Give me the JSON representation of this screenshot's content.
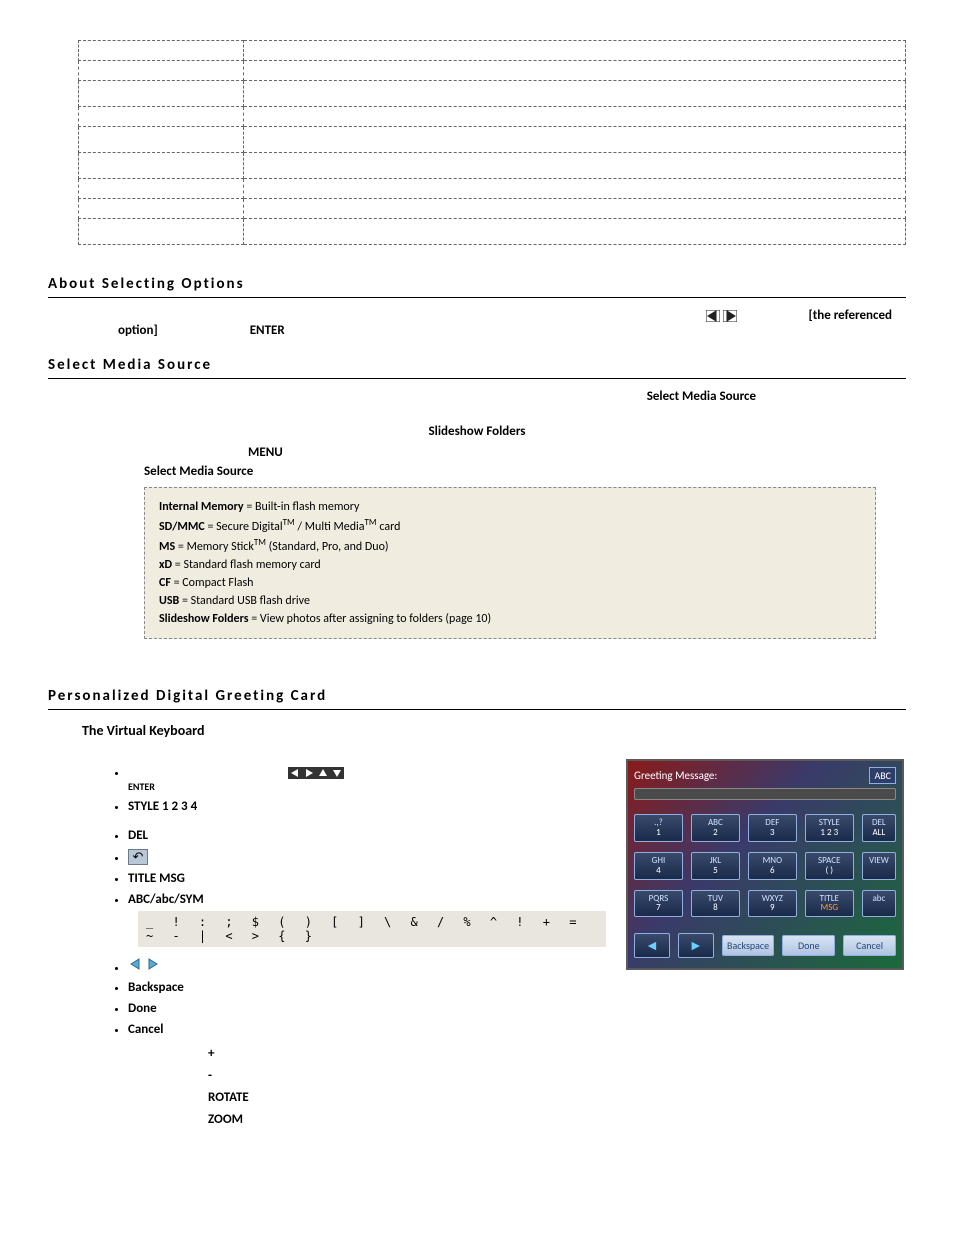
{
  "sections": {
    "about": "About Selecting Options",
    "select_media": "Select Media Source",
    "greeting": "Personalized Digital Greeting Card"
  },
  "about_line": {
    "trailing": "[the referenced",
    "option_word": "option]",
    "enter": "ENTER"
  },
  "media": {
    "select_label": "Select Media Source",
    "slideshow_folders": "Slideshow Folders",
    "menu": "MENU",
    "select_label2": "Select Media Source",
    "items": {
      "internal_memory_label": "Internal Memory",
      "internal_memory_desc": " = Built-in flash memory",
      "sd_label": "SD/MMC",
      "sd_desc_a": " = Secure Digital",
      "sd_desc_b": " / Multi Media",
      "sd_desc_c": " card",
      "ms_label": "MS",
      "ms_desc_a": " = Memory Stick",
      "ms_desc_b": " (Standard, Pro, and Duo)",
      "xd_label": "xD",
      "xd_desc": " = Standard flash memory card",
      "cf_label": "CF",
      "cf_desc": " = Compact Flash",
      "usb_label": "USB",
      "usb_desc": " = Standard USB flash drive",
      "sf_label": "Slideshow Folders",
      "sf_desc": " = View photos after assigning to folders (page 10)"
    }
  },
  "vk": {
    "title": "The Virtual Keyboard",
    "enter": "ENTER",
    "style": "STYLE 1 2 3 4",
    "del": "DEL",
    "title_msg": "TITLE MSG",
    "mode": "ABC/abc/SYM",
    "symbols": "_  !  :  ;  $  (  )  [  ]  \\  &  /  %  ^  !  +  =  ~  -  |  <  >  {  }",
    "backspace": "Backspace",
    "done": "Done",
    "cancel": "Cancel",
    "plus": "+",
    "minus": "-",
    "rotate": "ROTATE",
    "zoom": "ZOOM"
  },
  "kb_image": {
    "header": "Greeting Message:",
    "mode_badge": "ABC",
    "keys_main": [
      [
        ".,?",
        "1"
      ],
      [
        "ABC",
        "2"
      ],
      [
        "DEF",
        "3"
      ],
      [
        "STYLE",
        "1 2 3"
      ],
      [
        "DEL",
        "ALL"
      ],
      [
        "GHI",
        "4"
      ],
      [
        "JKL",
        "5"
      ],
      [
        "MNO",
        "6"
      ],
      [
        "SPACE",
        "( )"
      ],
      [
        "VIEW",
        ""
      ],
      [
        "PQRS",
        "7"
      ],
      [
        "TUV",
        "8"
      ],
      [
        "WXYZ",
        "9"
      ],
      [
        "TITLE",
        "MSG"
      ],
      [
        "abc",
        ""
      ]
    ],
    "bottom": {
      "left_nav": "◄",
      "right_nav": "►",
      "backspace": "Backspace",
      "done": "Done",
      "cancel": "Cancel"
    }
  }
}
